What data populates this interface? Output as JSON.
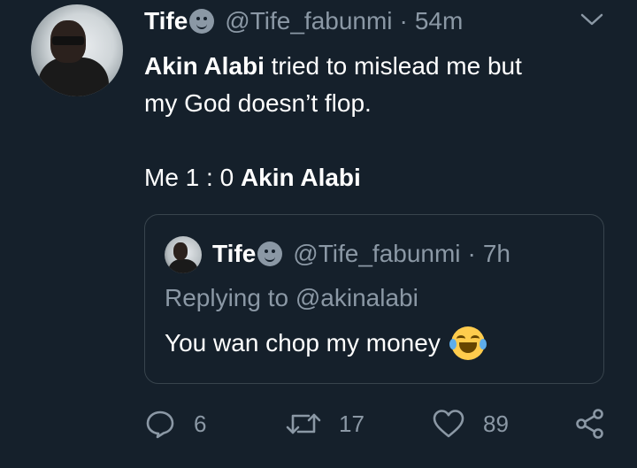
{
  "tweet": {
    "author_name": "Tife",
    "handle": "@Tife_fabunmi",
    "separator": "·",
    "time": "54m",
    "text": {
      "line1_mention": "Akin Alabi",
      "line1_rest": " tried to mislead me but",
      "line2": "my God doesn’t flop.",
      "line3_prefix": "Me 1 : 0 ",
      "line3_mention": "Akin Alabi"
    }
  },
  "quoted_tweet": {
    "author_name": "Tife",
    "handle": "@Tife_fabunmi",
    "separator": "·",
    "time": "7h",
    "replying_to": "Replying to @akinalabi",
    "text": "You wan chop my money"
  },
  "actions": {
    "reply_count": "6",
    "retweet_count": "17",
    "like_count": "89"
  },
  "icons": [
    "avatar",
    "emoji-badge-icon",
    "chevron-down-icon",
    "reply-icon",
    "retweet-icon",
    "like-icon",
    "share-icon",
    "laughing-emoji-icon"
  ],
  "colors": {
    "background": "#15202b",
    "text": "#ffffff",
    "muted": "#8b98a5",
    "border": "#38444d"
  }
}
